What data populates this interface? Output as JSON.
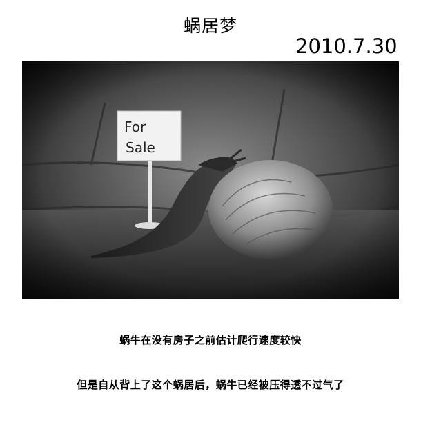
{
  "page": {
    "title": "蜗居梦",
    "date": "2010.7.30"
  },
  "photo": {
    "sign_text": "For Sale",
    "style": "black-and-white photograph of a slug wearing a snail shell beside a For Sale sign"
  },
  "captions": [
    "蜗牛在没有房子之前估计爬行速度较快",
    "但是自从背上了这个蜗居后，蜗牛已经被压得透不过气了"
  ]
}
